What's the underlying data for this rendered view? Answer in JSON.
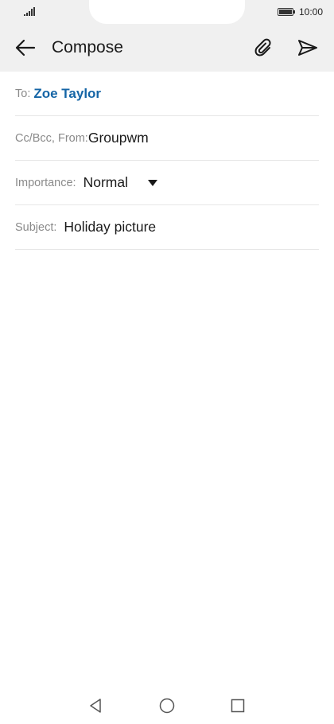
{
  "status_bar": {
    "time": "10:00",
    "signal_icon": "signal-icon",
    "battery_icon": "battery-icon"
  },
  "app_bar": {
    "title": "Compose",
    "back_icon": "arrow-left-icon",
    "attach_icon": "paperclip-icon",
    "send_icon": "send-icon"
  },
  "form": {
    "to": {
      "label": "To:",
      "value": "Zoe Taylor"
    },
    "cc_from": {
      "label": "Cc/Bcc, From:",
      "value": "Groupwm"
    },
    "importance": {
      "label": "Importance:",
      "value": "Normal"
    },
    "subject": {
      "label": "Subject:",
      "value": "Holiday picture"
    }
  },
  "nav_bar": {
    "back_icon": "triangle-back-icon",
    "home_icon": "circle-home-icon",
    "recents_icon": "square-recents-icon"
  },
  "colors": {
    "appbar_bg": "#f0f0f0",
    "recipient": "#1565a6",
    "label": "#8a8a8a",
    "divider": "#e6e6e6"
  }
}
